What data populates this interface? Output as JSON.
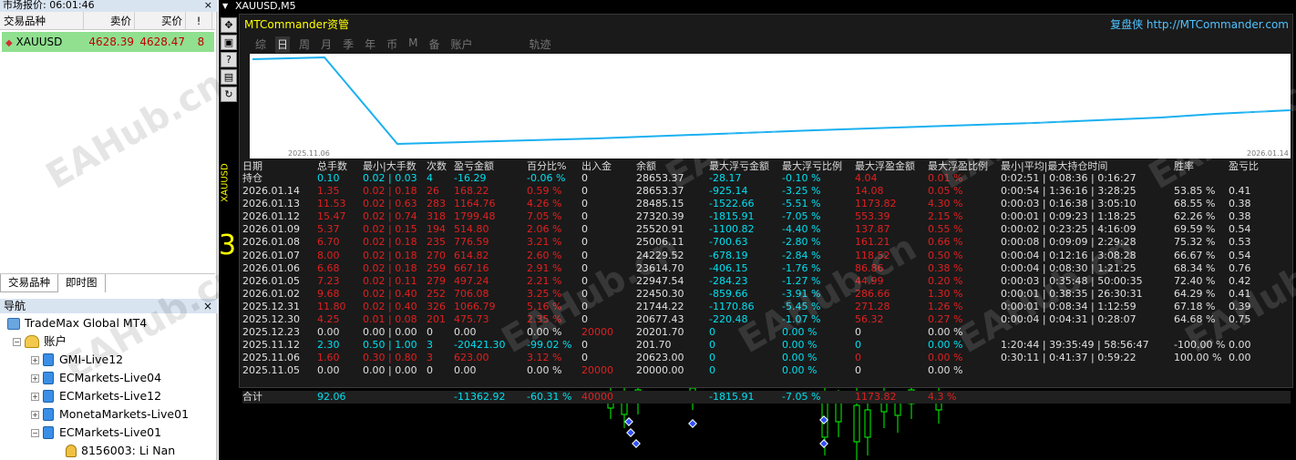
{
  "market_watch": {
    "title": "市场报价: 06:01:46",
    "close": "×",
    "headers": [
      "交易品种",
      "卖价",
      "买价",
      "!"
    ],
    "row": {
      "symbol": "XAUUSD",
      "bid": "4628.39",
      "ask": "4628.47",
      "spread": "8"
    },
    "tabs": [
      "交易品种",
      "即时图"
    ]
  },
  "navigator": {
    "title": "导航",
    "close": "×",
    "root": "TradeMax Global MT4",
    "group": "账户",
    "accounts": [
      "GMI-Live12",
      "ECMarkets-Live04",
      "ECMarkets-Live12",
      "MonetaMarkets-Live01",
      "ECMarkets-Live01"
    ],
    "user": "8156003: Li Nan"
  },
  "chart_window": {
    "title": "XAUUSD,M5"
  },
  "panel": {
    "title": "MTCommander资管",
    "link": "复盘侠 http://MTCommander.com",
    "tabs": [
      "综",
      "日",
      "周",
      "月",
      "季",
      "年",
      "币",
      "M",
      "备",
      "账户",
      "轨迹"
    ],
    "active_tab": "日",
    "equity_chart": {
      "start_label": "2025.11.06",
      "end_label": "2026.01.14",
      "line_color": "#1ab0f0"
    }
  },
  "chart_data": {
    "type": "line",
    "x": [
      "2025.11.06",
      "2026.01.14"
    ],
    "x_start": "2025.11.06",
    "x_end": "2026.01.14"
  },
  "table": {
    "headers": [
      "日期",
      "总手数",
      "最小|大手数",
      "次数",
      "盈亏金额",
      "百分比%",
      "出入金",
      "余额",
      "最大浮亏金额",
      "最大浮亏比例",
      "最大浮盈金额",
      "最大浮盈比例",
      "最小|平均|最大持仓时间",
      "胜率",
      "盈亏比"
    ],
    "holding": {
      "label": "持仓",
      "lots": "0.10",
      "minmax": "0.02 | 0.03",
      "count": "4",
      "pnl": "-16.29",
      "pct": "-0.06 %",
      "io": "0",
      "bal": "28653.37",
      "fl": "-28.17",
      "flp": "-0.10 %",
      "fp": "4.04",
      "fpp": "0.01 %",
      "time": "0:02:51 | 0:08:36 | 0:16:27"
    },
    "rows": [
      {
        "date": "2026.01.14",
        "lots": "1.35",
        "minmax": "0.02 | 0.18",
        "count": "26",
        "pnl": "168.22",
        "pct": "0.59 %",
        "io": "0",
        "bal": "28653.37",
        "fl": "-925.14",
        "flp": "-3.25 %",
        "fp": "14.08",
        "fpp": "0.05 %",
        "time": "0:00:54 | 1:36:16 | 3:28:25",
        "win": "53.85 %",
        "pf": "0.41",
        "c": "rd"
      },
      {
        "date": "2026.01.13",
        "lots": "11.53",
        "minmax": "0.02 | 0.63",
        "count": "283",
        "pnl": "1164.76",
        "pct": "4.26 %",
        "io": "0",
        "bal": "28485.15",
        "fl": "-1522.66",
        "flp": "-5.51 %",
        "fp": "1173.82",
        "fpp": "4.30 %",
        "time": "0:00:03 | 0:16:38 | 3:05:10",
        "win": "68.55 %",
        "pf": "0.38",
        "c": "rd"
      },
      {
        "date": "2026.01.12",
        "lots": "15.47",
        "minmax": "0.02 | 0.74",
        "count": "318",
        "pnl": "1799.48",
        "pct": "7.05 %",
        "io": "0",
        "bal": "27320.39",
        "fl": "-1815.91",
        "flp": "-7.05 %",
        "fp": "553.39",
        "fpp": "2.15 %",
        "time": "0:00:01 | 0:09:23 | 1:18:25",
        "win": "62.26 %",
        "pf": "0.38",
        "c": "rd"
      },
      {
        "date": "2026.01.09",
        "lots": "5.37",
        "minmax": "0.02 | 0.15",
        "count": "194",
        "pnl": "514.80",
        "pct": "2.06 %",
        "io": "0",
        "bal": "25520.91",
        "fl": "-1100.82",
        "flp": "-4.40 %",
        "fp": "137.87",
        "fpp": "0.55 %",
        "time": "0:00:02 | 0:23:25 | 4:16:09",
        "win": "69.59 %",
        "pf": "0.54",
        "c": "rd"
      },
      {
        "date": "2026.01.08",
        "lots": "6.70",
        "minmax": "0.02 | 0.18",
        "count": "235",
        "pnl": "776.59",
        "pct": "3.21 %",
        "io": "0",
        "bal": "25006.11",
        "fl": "-700.63",
        "flp": "-2.80 %",
        "fp": "161.21",
        "fpp": "0.66 %",
        "time": "0:00:08 | 0:09:09 | 2:29:28",
        "win": "75.32 %",
        "pf": "0.53",
        "c": "rd"
      },
      {
        "date": "2026.01.07",
        "lots": "8.00",
        "minmax": "0.02 | 0.18",
        "count": "270",
        "pnl": "614.82",
        "pct": "2.60 %",
        "io": "0",
        "bal": "24229.52",
        "fl": "-678.19",
        "flp": "-2.84 %",
        "fp": "118.52",
        "fpp": "0.50 %",
        "time": "0:00:04 | 0:12:16 | 3:08:28",
        "win": "66.67 %",
        "pf": "0.54",
        "c": "rd"
      },
      {
        "date": "2026.01.06",
        "lots": "6.68",
        "minmax": "0.02 | 0.18",
        "count": "259",
        "pnl": "667.16",
        "pct": "2.91 %",
        "io": "0",
        "bal": "23614.70",
        "fl": "-406.15",
        "flp": "-1.76 %",
        "fp": "86.86",
        "fpp": "0.38 %",
        "time": "0:00:04 | 0:08:30 | 1:21:25",
        "win": "68.34 %",
        "pf": "0.76",
        "c": "rd"
      },
      {
        "date": "2026.01.05",
        "lots": "7.23",
        "minmax": "0.02 | 0.11",
        "count": "279",
        "pnl": "497.24",
        "pct": "2.21 %",
        "io": "0",
        "bal": "22947.54",
        "fl": "-284.23",
        "flp": "-1.27 %",
        "fp": "44.99",
        "fpp": "0.20 %",
        "time": "0:00:03 | 0:35:48 | 50:00:35",
        "win": "72.40 %",
        "pf": "0.42",
        "c": "rd"
      },
      {
        "date": "2026.01.02",
        "lots": "9.68",
        "minmax": "0.02 | 0.40",
        "count": "252",
        "pnl": "706.08",
        "pct": "3.25 %",
        "io": "0",
        "bal": "22450.30",
        "fl": "-859.66",
        "flp": "-3.91 %",
        "fp": "286.66",
        "fpp": "1.30 %",
        "time": "0:00:01 | 0:38:35 | 26:30:31",
        "win": "64.29 %",
        "pf": "0.41",
        "c": "rd"
      },
      {
        "date": "2025.12.31",
        "lots": "11.80",
        "minmax": "0.02 | 0.40",
        "count": "326",
        "pnl": "1066.79",
        "pct": "5.16 %",
        "io": "0",
        "bal": "21744.22",
        "fl": "-1170.86",
        "flp": "-5.45 %",
        "fp": "271.28",
        "fpp": "1.26 %",
        "time": "0:00:01 | 0:08:34 | 1:12:59",
        "win": "67.18 %",
        "pf": "0.39",
        "c": "rd"
      },
      {
        "date": "2025.12.30",
        "lots": "4.25",
        "minmax": "0.01 | 0.08",
        "count": "201",
        "pnl": "475.73",
        "pct": "2.35 %",
        "io": "0",
        "bal": "20677.43",
        "fl": "-220.48",
        "flp": "-1.07 %",
        "fp": "56.32",
        "fpp": "0.27 %",
        "time": "0:00:04 | 0:04:31 | 0:28:07",
        "win": "64.68 %",
        "pf": "0.75",
        "c": "rd"
      },
      {
        "date": "2025.12.23",
        "lots": "0.00",
        "minmax": "0.00 | 0.00",
        "count": "0",
        "pnl": "0.00",
        "pct": "0.00 %",
        "io": "20000",
        "bal": "20201.70",
        "fl": "0",
        "flp": "0.00 %",
        "fp": "0",
        "fpp": "0.00 %",
        "time": "",
        "win": "",
        "pf": "",
        "c": "wh"
      },
      {
        "date": "2025.11.12",
        "lots": "2.30",
        "minmax": "0.50 | 1.00",
        "count": "3",
        "pnl": "-20421.30",
        "pct": "-99.02 %",
        "io": "0",
        "bal": "201.70",
        "fl": "0",
        "flp": "0.00 %",
        "fp": "0",
        "fpp": "0.00 %",
        "time": "1:20:44 | 39:35:49 | 58:56:47",
        "win": "-100.00 %",
        "pf": "0.00",
        "c": "cy"
      },
      {
        "date": "2025.11.06",
        "lots": "1.60",
        "minmax": "0.30 | 0.80",
        "count": "3",
        "pnl": "623.00",
        "pct": "3.12 %",
        "io": "0",
        "bal": "20623.00",
        "fl": "0",
        "flp": "0.00 %",
        "fp": "0",
        "fpp": "0.00 %",
        "time": "0:30:11 | 0:41:37 | 0:59:22",
        "win": "100.00 %",
        "pf": "0.00",
        "c": "rd"
      },
      {
        "date": "2025.11.05",
        "lots": "0.00",
        "minmax": "0.00 | 0.00",
        "count": "0",
        "pnl": "0.00",
        "pct": "0.00 %",
        "io": "20000",
        "bal": "20000.00",
        "fl": "0",
        "flp": "0.00 %",
        "fp": "0",
        "fpp": "0.00 %",
        "time": "",
        "win": "",
        "pf": "",
        "c": "wh"
      }
    ],
    "total": {
      "label": "合计",
      "lots": "92.06",
      "pnl": "-11362.92",
      "pct": "-60.31 %",
      "io": "40000",
      "fl": "-1815.91",
      "flp": "-7.05 %",
      "fp": "1173.82",
      "fpp": "4.3 %"
    }
  },
  "side_label": "XAUUSD",
  "watermark": "EAHub.cn"
}
